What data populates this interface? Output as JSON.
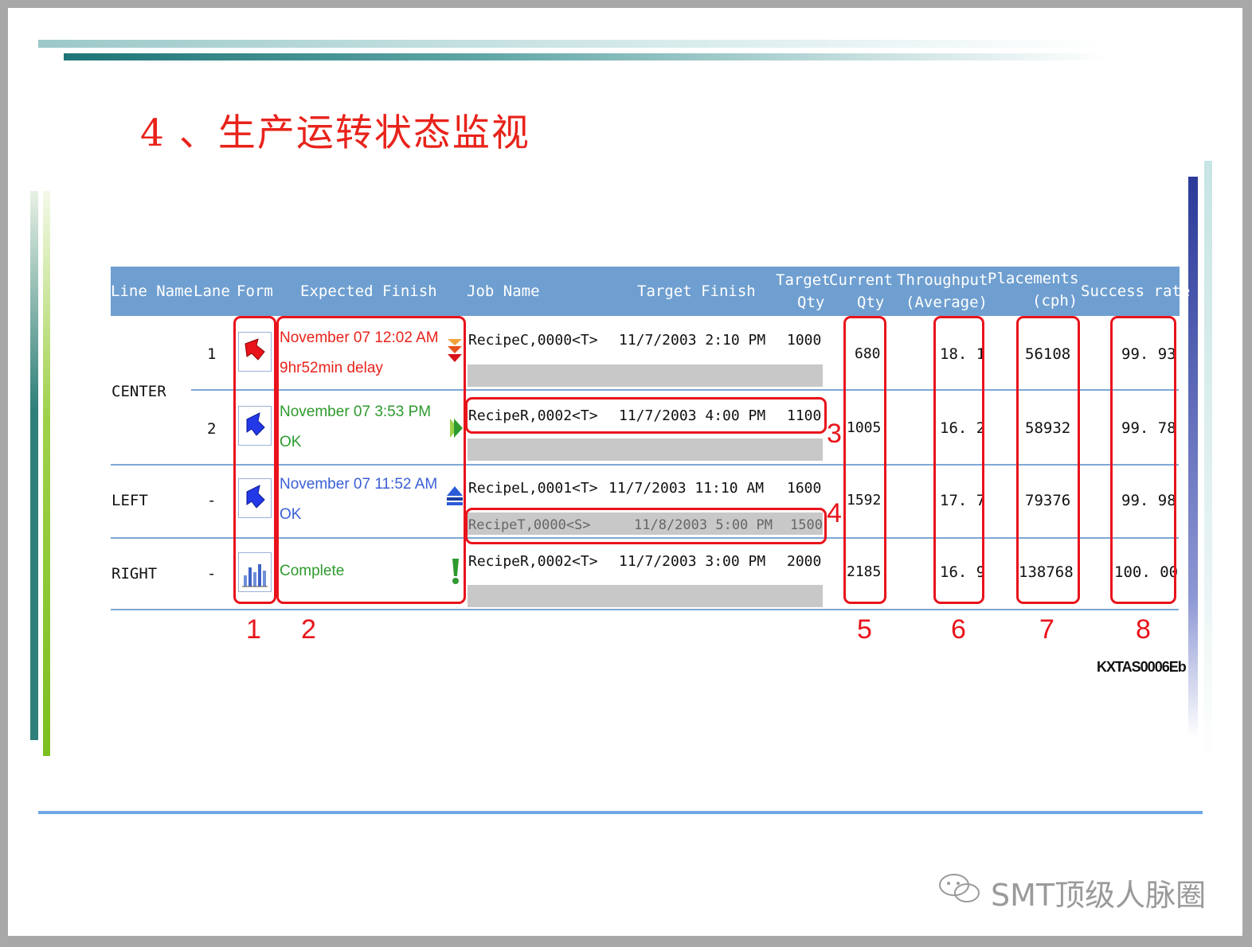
{
  "slide": {
    "title": "4 、生产运转状态监视",
    "code": "KXTAS0006Eb",
    "watermark": "SMT顶级人脉圈"
  },
  "table": {
    "headers": {
      "line_name": "Line Name",
      "lane": "Lane",
      "form": "Form",
      "expected_finish": "Expected Finish",
      "job_name": "Job Name",
      "target_finish": "Target Finish",
      "target_qty_1": "Target",
      "target_qty_2": "Qty",
      "current_qty_1": "Current",
      "current_qty_2": "Qty",
      "throughput_1": "Throughput",
      "throughput_2": "(Average)",
      "placements_1": "Placements",
      "placements_2": "(cph)",
      "success_rate": "Success rate"
    },
    "lines": [
      {
        "name": "CENTER"
      },
      {
        "name": "LEFT"
      },
      {
        "name": "RIGHT"
      }
    ],
    "rows": [
      {
        "lane": "1",
        "form_icon": "red-arrow-icon",
        "expected": "November 07 12:02 AM",
        "expected_sub": "9hr52min delay",
        "status_icon": "down-arrows-icon",
        "job": "RecipeC,0000<T>",
        "target_finish": "11/7/2003 2:10 PM",
        "target_qty": "1000",
        "current_qty": "680",
        "throughput": "18. 1",
        "placements": "56108",
        "success": "99. 93"
      },
      {
        "lane": "2",
        "form_icon": "blue-arrow-icon",
        "expected": "November 07 3:53 PM",
        "expected_sub": "OK",
        "status_icon": "right-arrow-icon",
        "job": "RecipeR,0002<T>",
        "target_finish": "11/7/2003 4:00 PM",
        "target_qty": "1100",
        "current_qty": "1005",
        "throughput": "16. 2",
        "placements": "58932",
        "success": "99. 78"
      },
      {
        "lane": "-",
        "form_icon": "blue-arrow-icon",
        "expected": "November 07 11:52 AM",
        "expected_sub": "OK",
        "status_icon": "up-arrow-icon",
        "job": "RecipeL,0001<T>",
        "target_finish": "11/7/2003 11:10 AM",
        "target_qty": "1600",
        "current_qty": "1592",
        "throughput": "17. 7",
        "placements": "79376",
        "success": "99. 98",
        "next_job": "RecipeT,0000<S>",
        "next_target_finish": "11/8/2003 5:00 PM",
        "next_target_qty": "1500"
      },
      {
        "lane": "-",
        "form_icon": "bar-chart-icon",
        "expected": "Complete",
        "status_icon": "exclamation-icon",
        "job": "RecipeR,0002<T>",
        "target_finish": "11/7/2003 3:00 PM",
        "target_qty": "2000",
        "current_qty": "2185",
        "throughput": "16. 9",
        "placements": "138768",
        "success": "100. 00"
      }
    ]
  },
  "annotations": [
    "1",
    "2",
    "3",
    "4",
    "5",
    "6",
    "7",
    "8"
  ],
  "colors": {
    "title": "#e8231b",
    "header_bg": "#6f9fd0",
    "annotation": "#e8131b",
    "delay_text": "#e8231b",
    "ok_text": "#2e9a2e",
    "left_text": "#3b5fd6"
  }
}
